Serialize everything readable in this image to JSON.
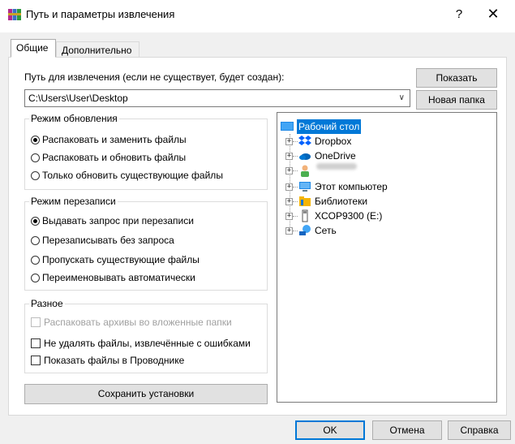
{
  "window": {
    "title": "Путь и параметры извлечения",
    "help_glyph": "?",
    "close_glyph": "✕"
  },
  "tabs": [
    {
      "label": "Общие",
      "active": true
    },
    {
      "label": "Дополнительно",
      "active": false
    }
  ],
  "path": {
    "label": "Путь для извлечения (если не существует, будет создан):",
    "value": "C:\\Users\\User\\Desktop",
    "show_button": "Показать",
    "new_folder_button": "Новая папка"
  },
  "update_mode": {
    "title": "Режим обновления",
    "options": [
      {
        "label": "Распаковать и заменить файлы",
        "selected": true
      },
      {
        "label": "Распаковать и обновить файлы",
        "selected": false
      },
      {
        "label": "Только обновить существующие файлы",
        "selected": false
      }
    ]
  },
  "overwrite_mode": {
    "title": "Режим перезаписи",
    "options": [
      {
        "label": "Выдавать запрос при перезаписи",
        "selected": true
      },
      {
        "label": "Перезаписывать без запроса",
        "selected": false
      },
      {
        "label": "Пропускать существующие файлы",
        "selected": false
      },
      {
        "label": "Переименовывать автоматически",
        "selected": false
      }
    ]
  },
  "misc": {
    "title": "Разное",
    "options": [
      {
        "label": "Распаковать архивы во вложенные папки",
        "checked": false,
        "disabled": true
      },
      {
        "label": "Не удалять файлы, извлечённые с ошибками",
        "checked": false,
        "disabled": false
      },
      {
        "label": "Показать файлы в Проводнике",
        "checked": false,
        "disabled": false
      }
    ]
  },
  "save_button": "Сохранить установки",
  "tree": {
    "root": {
      "label": "Рабочий стол",
      "icon": "desktop-icon",
      "selected": true
    },
    "items": [
      {
        "label": "Dropbox",
        "icon": "dropbox-icon"
      },
      {
        "label": "OneDrive",
        "icon": "onedrive-icon"
      },
      {
        "label": "",
        "icon": "user-icon",
        "blurred": true
      },
      {
        "label": "Этот компьютер",
        "icon": "computer-icon"
      },
      {
        "label": "Библиотеки",
        "icon": "libraries-icon"
      },
      {
        "label": "XCOP9300 (E:)",
        "icon": "usb-drive-icon"
      },
      {
        "label": "Сеть",
        "icon": "network-icon"
      }
    ]
  },
  "footer": {
    "ok": "OK",
    "cancel": "Отмена",
    "help": "Справка"
  },
  "colors": {
    "accent": "#0078d7",
    "dialog_bg": "#f0f0f0"
  }
}
